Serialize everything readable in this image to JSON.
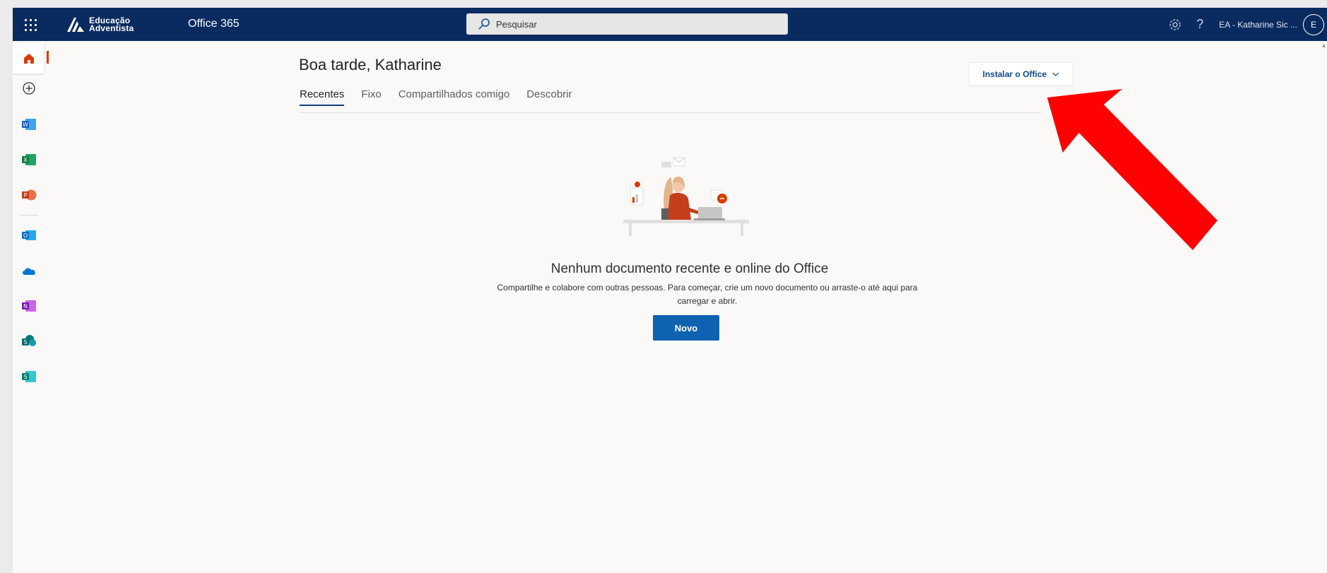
{
  "topbar": {
    "org_line1": "Educação",
    "org_line2": "Adventista",
    "app_name": "Office 365",
    "search_placeholder": "Pesquisar",
    "user_label": "EA - Katharine Sic ...",
    "avatar_initial": "E"
  },
  "rail": {
    "items": [
      {
        "name": "home",
        "color": "#d83b01"
      },
      {
        "name": "create",
        "color": "#323130"
      },
      {
        "name": "word",
        "color": "#185abd"
      },
      {
        "name": "excel",
        "color": "#107c41"
      },
      {
        "name": "powerpoint",
        "color": "#c43e1c"
      },
      {
        "name": "outlook",
        "color": "#0f6cbd"
      },
      {
        "name": "onedrive",
        "color": "#0078d4"
      },
      {
        "name": "onenote",
        "color": "#7719aa"
      },
      {
        "name": "sharepoint",
        "color": "#038387"
      },
      {
        "name": "sway",
        "color": "#008272"
      }
    ]
  },
  "main": {
    "greeting": "Boa tarde, Katharine",
    "tabs": [
      {
        "label": "Recentes",
        "active": true
      },
      {
        "label": "Fixo",
        "active": false
      },
      {
        "label": "Compartilhados comigo",
        "active": false
      },
      {
        "label": "Descobrir",
        "active": false
      }
    ],
    "install_label": "Instalar o Office",
    "empty_title": "Nenhum documento recente e online do Office",
    "empty_desc": "Compartilhe e colabore com outras pessoas. Para começar, crie um novo documento ou arraste-o até aqui para carregar e abrir.",
    "new_label": "Novo"
  },
  "colors": {
    "topbar": "#0a2b60",
    "accent": "#d83b01",
    "primary_button": "#0f62b0",
    "annotation_arrow": "#ff0000"
  }
}
